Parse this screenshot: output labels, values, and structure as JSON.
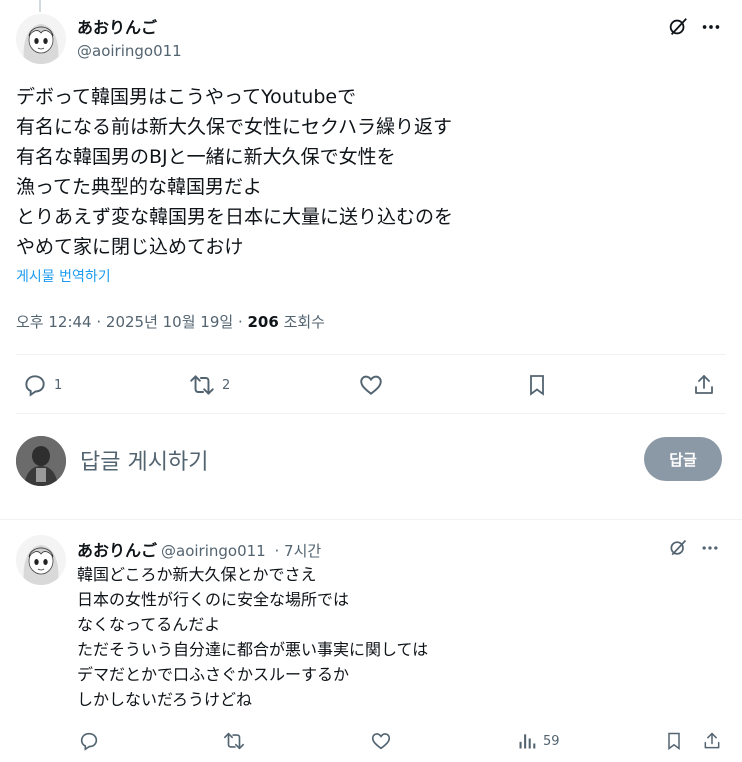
{
  "tweet": {
    "display_name": "あおりんご",
    "handle": "@aoiringo011",
    "body_lines": [
      "デボって韓国男はこうやってYoutubeで",
      "有名になる前は新大久保で女性にセクハラ繰り返す",
      "有名な韓国男のBJと一緒に新大久保で女性を",
      "漁ってた典型的な韓国男だよ",
      "とりあえず変な韓国男を日本に大量に送り込むのを",
      "やめて家に閉じ込めておけ"
    ],
    "translate_label": "게시물 번역하기",
    "timestamp": "오후 12:44 · 2025년 10월 19일 · ",
    "views_count": "206",
    "views_label": " 조회수",
    "replies": "1",
    "reposts": "2"
  },
  "composer": {
    "placeholder": "답글 게시하기",
    "button_label": "답글"
  },
  "reply": {
    "display_name": "あおりんご",
    "handle": "@aoiringo011",
    "time": " · 7시간",
    "body_lines": [
      "韓国どころか新大久保とかでさえ",
      "日本の女性が行くのに安全な場所では",
      "なくなってるんだよ",
      "ただそういう自分達に都合が悪い事実に関しては",
      "デマだとかで口ふさぐかスルーするか",
      "しかしないだろうけどね"
    ],
    "views": "59"
  },
  "icons": {
    "reply": "reply-icon",
    "repost": "repost-icon",
    "like": "like-icon",
    "bookmark": "bookmark-icon",
    "share": "share-icon",
    "grok": "grok-icon",
    "more": "more-icon",
    "views": "views-icon"
  },
  "colors": {
    "accent": "#1d9bf0",
    "muted": "#536471",
    "button_disabled": "#8b98a5"
  }
}
